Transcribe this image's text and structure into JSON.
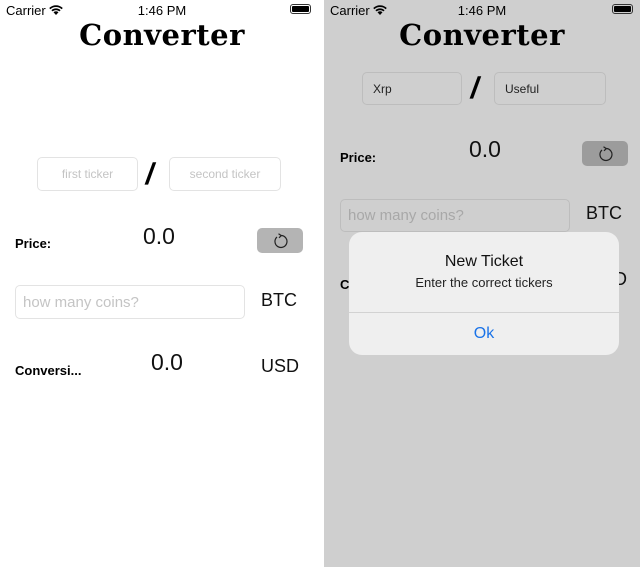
{
  "status": {
    "carrier": "Carrier",
    "time": "1:46 PM"
  },
  "left": {
    "title": "Converter",
    "first_ticker_placeholder": "first ticker",
    "second_ticker_placeholder": "second ticker",
    "separator": "/",
    "price_label": "Price:",
    "price_value": "0.0",
    "coins_placeholder": "how many coins?",
    "coin_currency": "BTC",
    "conversion_label": "Conversi...",
    "conversion_value": "0.0",
    "conversion_currency": "USD"
  },
  "right": {
    "title": "Converter",
    "first_ticker_value": "Xrp",
    "second_ticker_value": "Useful",
    "separator": "/",
    "price_label": "Price:",
    "price_value": "0.0",
    "coins_placeholder": "how many coins?",
    "coin_currency": "BTC",
    "conversion_label_partial": "C",
    "conversion_currency_partial": "D"
  },
  "alert": {
    "title": "New Ticket",
    "message": "Enter the correct tickers",
    "ok_label": "Ok",
    "accent": "#1a73e8"
  }
}
